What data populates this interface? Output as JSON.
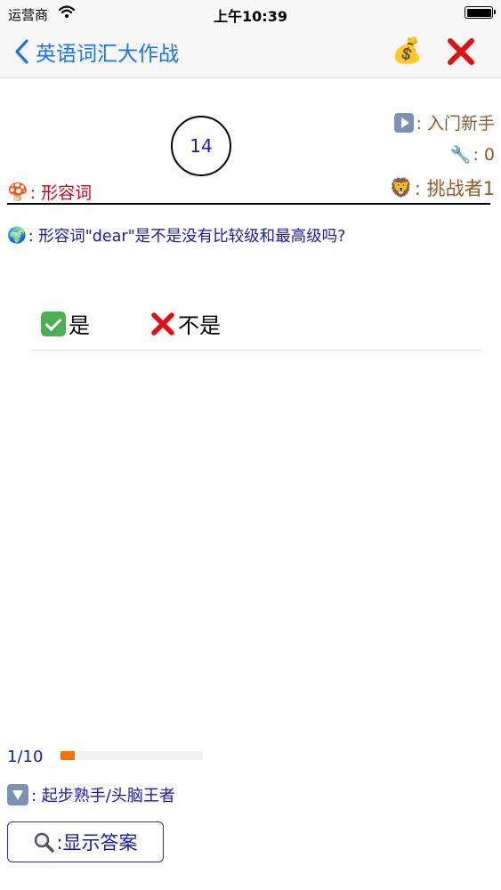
{
  "status_bar": {
    "carrier": "运营商",
    "time": "上午10:39"
  },
  "nav": {
    "title": "英语词汇大作战",
    "money_icon": "money-bag-icon",
    "close_icon": "close-icon"
  },
  "game": {
    "timer": "14",
    "level": ": 入门新手",
    "tools": ": 0",
    "player": ": 挑战者1",
    "category": ": 形容词"
  },
  "question": {
    "text": ": 形容词\"dear\"是不是没有比较级和最高级吗?"
  },
  "answers": [
    {
      "label": "是"
    },
    {
      "label": "不是"
    }
  ],
  "progress": {
    "label": "1/10",
    "fraction": 0.1,
    "color": "#f5730a"
  },
  "hint": {
    "text": ": 起步熟手/头脑王者"
  },
  "show_answer": {
    "label": ":显示答案"
  },
  "colors": {
    "accent": "#1a73e8",
    "question_text": "#1a1aa8",
    "category_red": "#d0021b",
    "info_brown": "#8b5a2b"
  }
}
